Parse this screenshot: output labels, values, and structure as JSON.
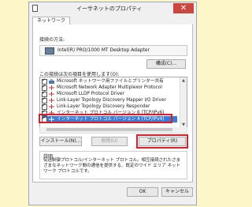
{
  "window": {
    "title": "イーサネットのプロパティ",
    "close_glyph": "✕"
  },
  "tabs": [
    {
      "label": "ネットワーク"
    }
  ],
  "connection": {
    "label": "接続の方法:",
    "adapter": "Intel(R) PRO/1000 MT Desktop Adapter",
    "configure_button": "構成(C)..."
  },
  "items_label": "この接続は次の項目を使用します(O):",
  "items": [
    {
      "text": "Microsoft ネットワーク用ファイルとプリンター共有",
      "checked": true
    },
    {
      "text": "Microsoft Network Adapter Multiplexor Protocol",
      "checked": true
    },
    {
      "text": "Microsoft LLDP Protocol Driver",
      "checked": true
    },
    {
      "text": "Link-Layer Topology Discovery Mapper I/O Driver",
      "checked": true
    },
    {
      "text": "Link-Layer Topology Discovery Responder",
      "checked": true
    },
    {
      "text": "インターネット プロトコル バージョン 6 (TCP/IPv6)",
      "checked": true
    },
    {
      "text": "インターネット プロトコル バージョン 4 (TCP/IPv4)",
      "checked": true,
      "selected": true
    }
  ],
  "buttons": {
    "install": "インストール(N)...",
    "uninstall": "削除(U)",
    "properties": "プロパティ(R)",
    "ok": "OK",
    "cancel": "キャンセル"
  },
  "description": {
    "label": "説明",
    "text": "伝送制御プロトコル/インターネット プロトコル。相互接続されたさまざまなネットワーク間の通信を提供する、既定のワイド エリア ネットワーク プロトコルです。"
  },
  "colors": {
    "highlight": "#d8202a",
    "selection": "#3a7bd5",
    "close": "#c9473d"
  }
}
